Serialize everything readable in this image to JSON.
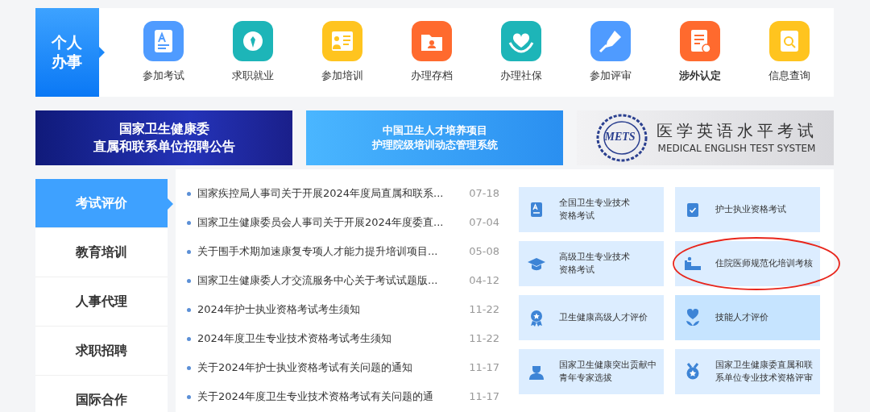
{
  "personal_services": {
    "title": "个人办事",
    "items": [
      {
        "label": "参加考试",
        "color": "#4f9bff",
        "bold": false
      },
      {
        "label": "求职就业",
        "color": "#1db5b8",
        "bold": false
      },
      {
        "label": "参加培训",
        "color": "#ffc41f",
        "bold": false
      },
      {
        "label": "办理存档",
        "color": "#ff6a2e",
        "bold": false
      },
      {
        "label": "办理社保",
        "color": "#1db5b8",
        "bold": false
      },
      {
        "label": "参加评审",
        "color": "#4f9bff",
        "bold": false
      },
      {
        "label": "涉外认定",
        "color": "#ff6a2e",
        "bold": true
      },
      {
        "label": "信息查询",
        "color": "#ffc41f",
        "bold": false
      }
    ]
  },
  "banners": [
    {
      "kind": "recruit",
      "lines": [
        "国家卫生健康委",
        "直属和联系单位招聘公告"
      ]
    },
    {
      "kind": "training",
      "lines": [
        "中国卫生人才培养项目",
        "护理院级培训动态管理系统"
      ]
    },
    {
      "kind": "mets",
      "logo": "METS",
      "lines": [
        "医学英语水平考试",
        "MEDICAL ENGLISH TEST SYSTEM"
      ]
    }
  ],
  "sidebar": {
    "items": [
      {
        "label": "考试评价",
        "selected": true
      },
      {
        "label": "教育培训",
        "selected": false
      },
      {
        "label": "人事代理",
        "selected": false
      },
      {
        "label": "求职招聘",
        "selected": false
      },
      {
        "label": "国际合作",
        "selected": false
      }
    ]
  },
  "news": [
    {
      "title": "国家疾控局人事司关于开展2024年度局直属和联系...",
      "date": "07-18"
    },
    {
      "title": "国家卫生健康委员会人事司关于开展2024年度委直...",
      "date": "07-04"
    },
    {
      "title": "关于围手术期加速康复专项人才能力提升培训项目...",
      "date": "05-08"
    },
    {
      "title": "国家卫生健康委人才交流服务中心关于考试试题版...",
      "date": "04-12"
    },
    {
      "title": "2024年护士执业资格考试考生须知",
      "date": "11-22"
    },
    {
      "title": "2024年度卫生专业技术资格考试考生须知",
      "date": "11-22"
    },
    {
      "title": "关于2024年护士执业资格考试有关问题的通知",
      "date": "11-17"
    },
    {
      "title": "关于2024年度卫生专业技术资格考试有关问题的通",
      "date": "11-17"
    }
  ],
  "exam_cards": [
    {
      "lines": [
        "全国卫生专业技术",
        "资格考试"
      ],
      "hovered": false,
      "circled": false
    },
    {
      "lines": [
        "护士执业资格考试"
      ],
      "hovered": false,
      "circled": false
    },
    {
      "lines": [
        "高级卫生专业技术",
        "资格考试"
      ],
      "hovered": false,
      "circled": false
    },
    {
      "lines": [
        "住院医师规范化培训考核"
      ],
      "hovered": false,
      "circled": true
    },
    {
      "lines": [
        "卫生健康高级人才评价"
      ],
      "hovered": false,
      "circled": false
    },
    {
      "lines": [
        "技能人才评价"
      ],
      "hovered": true,
      "circled": false
    },
    {
      "lines": [
        "国家卫生健康突出贡献中",
        "青年专家选拔"
      ],
      "hovered": false,
      "circled": false
    },
    {
      "lines": [
        "国家卫生健康委直属和联",
        "系单位专业技术资格评审"
      ],
      "hovered": false,
      "circled": false
    }
  ]
}
